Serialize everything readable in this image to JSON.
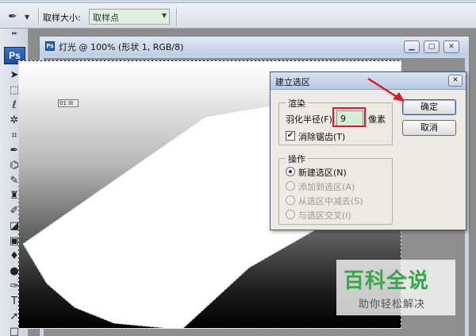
{
  "options_bar": {
    "tool_glyph": "✒",
    "sample_size_label": "取样大小:",
    "sample_size_value": "取样点"
  },
  "toolbox": {
    "logo": "Ps",
    "tools": [
      {
        "name": "move-tool-icon",
        "glyph": "➤"
      },
      {
        "name": "marquee-tool-icon",
        "glyph": "⬚"
      },
      {
        "name": "lasso-tool-icon",
        "glyph": "ℓ"
      },
      {
        "name": "magic-wand-tool-icon",
        "glyph": "✲"
      },
      {
        "name": "crop-tool-icon",
        "glyph": "⌗"
      },
      {
        "name": "eyedropper-tool-icon",
        "glyph": "✒"
      },
      {
        "name": "healing-tool-icon",
        "glyph": "⌬"
      },
      {
        "name": "brush-tool-icon",
        "glyph": "✎"
      },
      {
        "name": "stamp-tool-icon",
        "glyph": "♜"
      },
      {
        "name": "history-brush-tool-icon",
        "glyph": "✐"
      },
      {
        "name": "eraser-tool-icon",
        "glyph": "◪"
      },
      {
        "name": "gradient-tool-icon",
        "glyph": "▣"
      },
      {
        "name": "blur-tool-icon",
        "glyph": "♦"
      },
      {
        "name": "dodge-tool-icon",
        "glyph": "●"
      },
      {
        "name": "pen-tool-icon",
        "glyph": "✑"
      },
      {
        "name": "type-tool-icon",
        "glyph": "T"
      },
      {
        "name": "path-select-tool-icon",
        "glyph": "➚"
      },
      {
        "name": "shape-tool-icon",
        "glyph": "□"
      }
    ]
  },
  "document": {
    "title": "灯光 @ 100% (形状 1, RGB/8)",
    "layer_tag": "01 ☒"
  },
  "dialog": {
    "title": "建立选区",
    "render_group": "渲染",
    "feather_label": "羽化半径(F):",
    "feather_value": "9",
    "feather_unit": "像素",
    "anti_alias_label": "消除锯齿(T)",
    "anti_alias_checked": true,
    "operation_group": "操作",
    "operations": [
      {
        "label": "新建选区(N)",
        "selected": true,
        "enabled": true
      },
      {
        "label": "添加到选区(A)",
        "selected": false,
        "enabled": false
      },
      {
        "label": "从选区中减去(S)",
        "selected": false,
        "enabled": false
      },
      {
        "label": "与选区交叉(I)",
        "selected": false,
        "enabled": false
      }
    ],
    "ok_label": "确定",
    "cancel_label": "取消"
  },
  "watermark": {
    "main": "百科全说",
    "sub": "助你轻松解决"
  },
  "colors": {
    "highlight": "#e0162b",
    "watermark_green": "#35a946"
  }
}
